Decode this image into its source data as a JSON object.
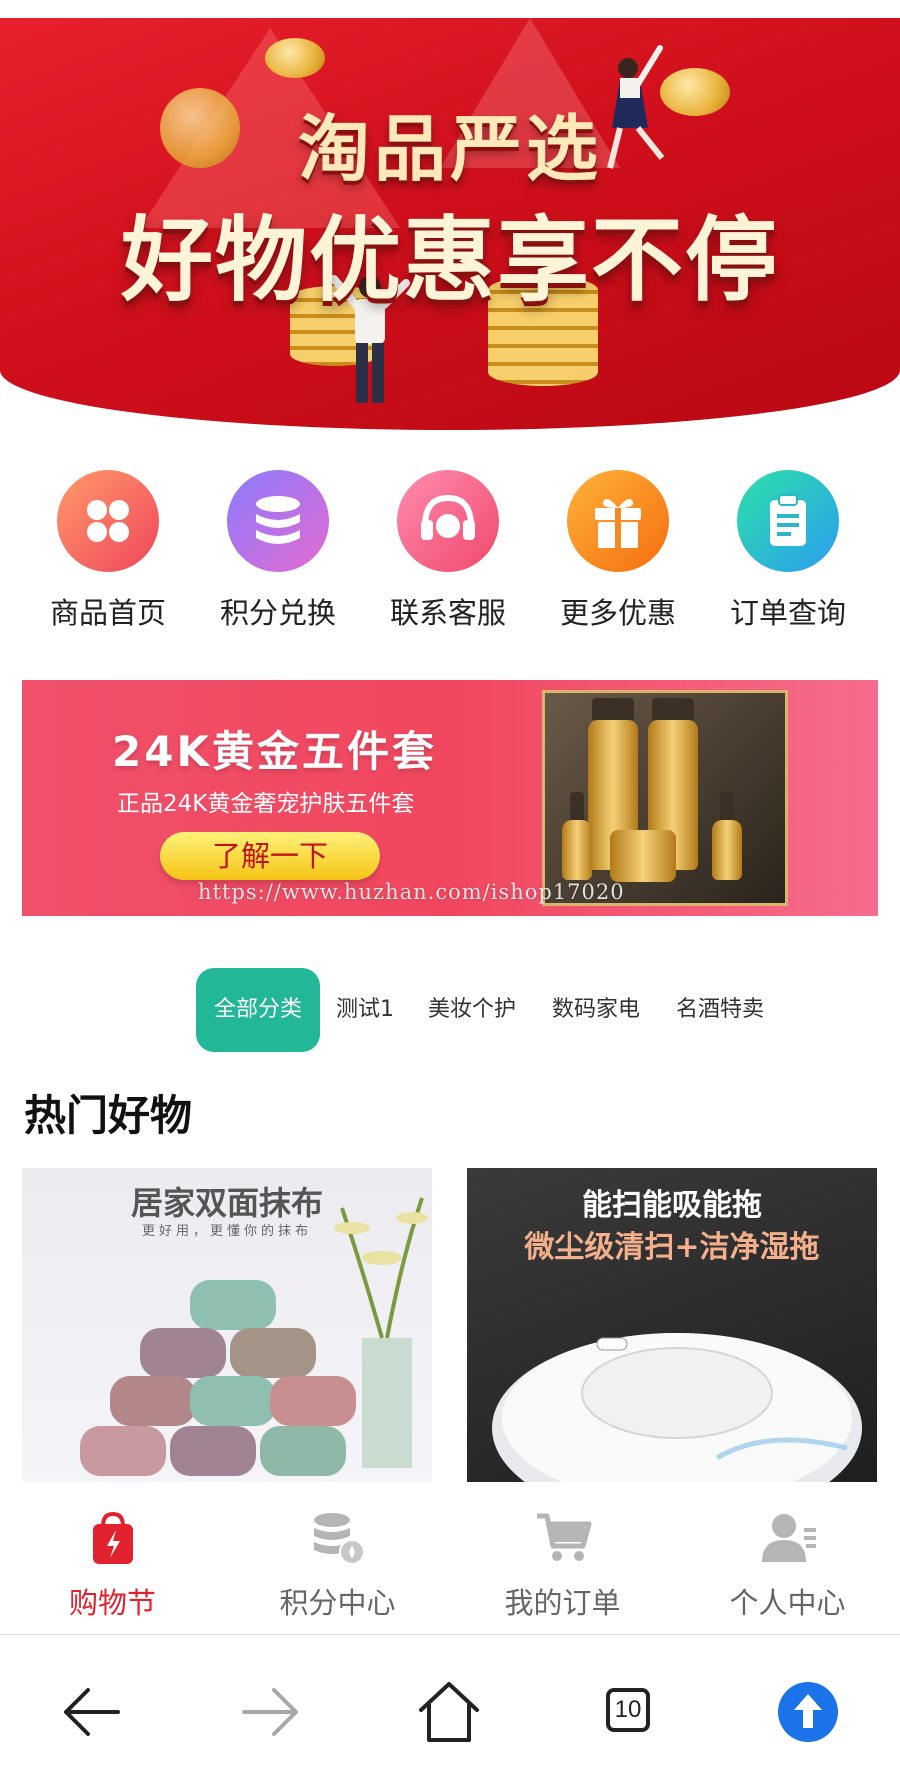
{
  "hero": {
    "title_line1": "淘品严选",
    "title_line2": "好物优惠享不停"
  },
  "quick_nav": [
    {
      "label": "商品首页",
      "icon": "grid-icon",
      "color_from": "#ff9a6a",
      "color_to": "#f0465c"
    },
    {
      "label": "积分兑换",
      "icon": "database-icon",
      "color_from": "#8a7bff",
      "color_to": "#e46ad0"
    },
    {
      "label": "联系客服",
      "icon": "headset-icon",
      "color_from": "#ff8db0",
      "color_to": "#f0486a"
    },
    {
      "label": "更多优惠",
      "icon": "gift-icon",
      "color_from": "#ffb238",
      "color_to": "#f56e10"
    },
    {
      "label": "订单查询",
      "icon": "clipboard-icon",
      "color_from": "#2ee0a8",
      "color_to": "#2a9df0"
    }
  ],
  "promo": {
    "title": "24K黄金五件套",
    "subtitle": "正品24K黄金奢宠护肤五件套",
    "button": "了解一下",
    "watermark": "https://www.huzhan.com/ishop17020"
  },
  "categories": [
    "全部分类",
    "测试1",
    "美妆个护",
    "数码家电",
    "名酒特卖"
  ],
  "section_title": "热门好物",
  "products": [
    {
      "title": "居家双面抹布",
      "subtitle": "更好用，更懂你的抹布"
    },
    {
      "title": "能扫能吸能拖",
      "subtitle": "微尘级清扫+洁净湿拖"
    }
  ],
  "tabbar": [
    {
      "label": "购物节",
      "icon": "shopping-bag-icon",
      "active": true
    },
    {
      "label": "积分中心",
      "icon": "coins-icon",
      "active": false
    },
    {
      "label": "我的订单",
      "icon": "cart-icon",
      "active": false
    },
    {
      "label": "个人中心",
      "icon": "user-icon",
      "active": false
    }
  ],
  "browser": {
    "tab_count": "10"
  },
  "colors": {
    "accent_red": "#e2222e",
    "category_active": "#22b796"
  }
}
